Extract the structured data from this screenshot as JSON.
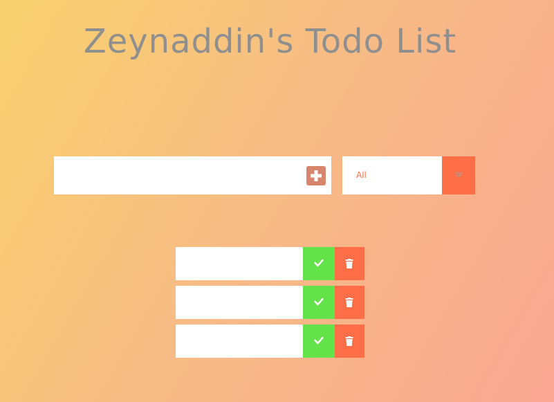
{
  "header": {
    "title": "Zeynaddin's Todo List"
  },
  "add_form": {
    "input_value": "",
    "input_placeholder": "",
    "add_icon": "plus-square-icon"
  },
  "filter": {
    "selected": "All",
    "arrow_icon": "chevron-down-icon"
  },
  "todos": [
    {
      "text": "",
      "complete_icon": "check-icon",
      "delete_icon": "trash-icon"
    },
    {
      "text": "",
      "complete_icon": "check-icon",
      "delete_icon": "trash-icon"
    },
    {
      "text": "",
      "complete_icon": "check-icon",
      "delete_icon": "trash-icon"
    }
  ],
  "colors": {
    "accent": "#ff6f47",
    "complete": "#62e349",
    "add_button": "#d8856d",
    "title": "#8f8f8f"
  }
}
